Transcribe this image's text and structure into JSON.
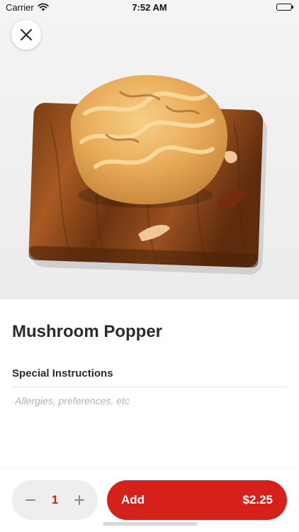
{
  "status_bar": {
    "carrier": "Carrier",
    "time": "7:52 AM",
    "wifi_icon": "wifi-icon",
    "battery_icon": "battery-icon"
  },
  "hero": {
    "image": "product-photo",
    "close_icon": "close-icon"
  },
  "product": {
    "title": "Mushroom Popper"
  },
  "special_instructions": {
    "label": "Special Instructions",
    "value": "",
    "placeholder": "Allergies, preferences, etc"
  },
  "order": {
    "quantity": "1",
    "minus_icon": "minus-icon",
    "plus_icon": "plus-icon",
    "add_label": "Add",
    "price": "$2.25"
  },
  "colors": {
    "accent": "#d6201a",
    "stepper_bg": "#eeeeee",
    "text": "#2b2b2b",
    "placeholder": "#b3b3b3"
  }
}
